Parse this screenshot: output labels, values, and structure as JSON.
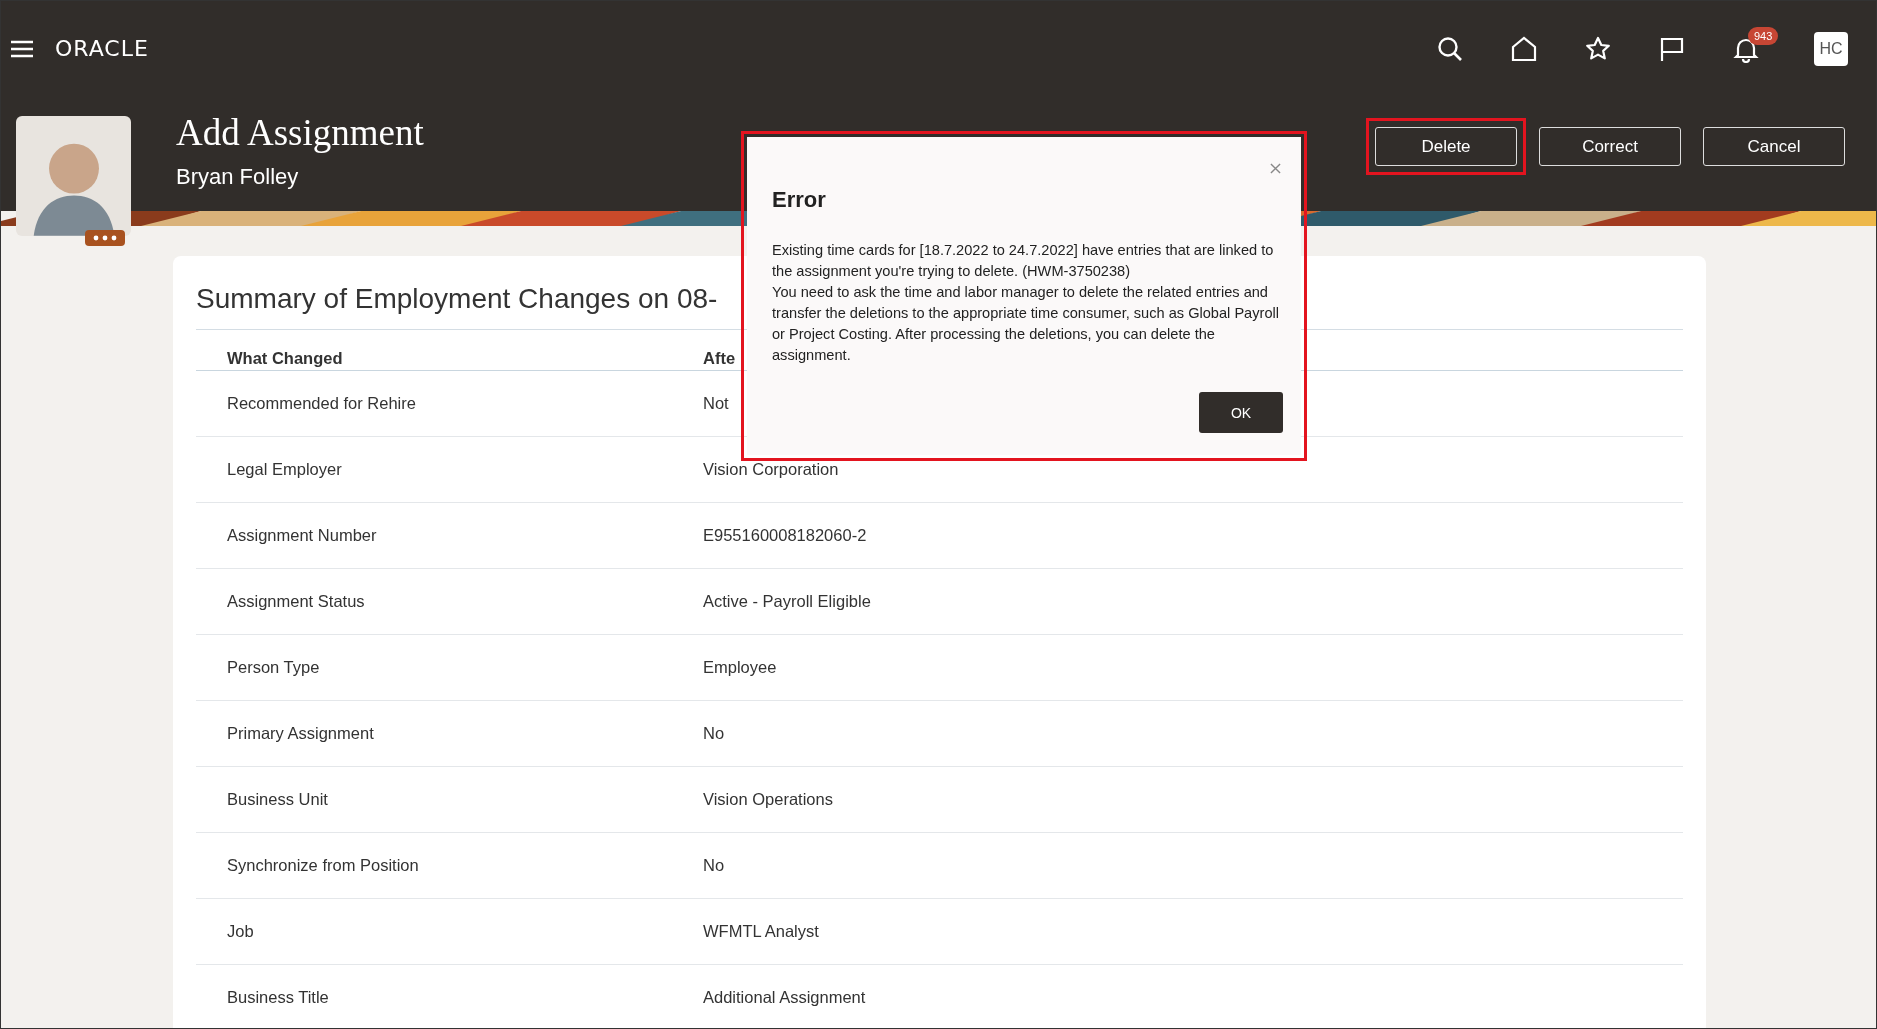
{
  "top_bar": {
    "logo": "ORACLE",
    "notification_count": "943",
    "user_initials": "HC"
  },
  "header": {
    "title": "Add Assignment",
    "subtitle": "Bryan Folley",
    "buttons": [
      {
        "label": "Delete",
        "highlighted": true
      },
      {
        "label": "Correct",
        "highlighted": false
      },
      {
        "label": "Cancel",
        "highlighted": false
      }
    ]
  },
  "summary": {
    "title": "Summary of Employment Changes on 08-",
    "columns": [
      "What Changed",
      "Afte"
    ],
    "rows": [
      {
        "field": "Recommended for Rehire",
        "value": "Not"
      },
      {
        "field": "Legal Employer",
        "value": "Vision Corporation"
      },
      {
        "field": "Assignment Number",
        "value": "E955160008182060-2"
      },
      {
        "field": "Assignment Status",
        "value": "Active - Payroll Eligible"
      },
      {
        "field": "Person Type",
        "value": "Employee"
      },
      {
        "field": "Primary Assignment",
        "value": "No"
      },
      {
        "field": "Business Unit",
        "value": "Vision Operations"
      },
      {
        "field": "Synchronize from Position",
        "value": "No"
      },
      {
        "field": "Job",
        "value": "WFMTL Analyst"
      },
      {
        "field": "Business Title",
        "value": "Additional Assignment"
      }
    ]
  },
  "dialog": {
    "title": "Error",
    "highlighted": true,
    "paragraphs": [
      "Existing time cards for [18.7.2022 to 24.7.2022] have entries that are linked to the assignment you're trying to delete. (HWM-3750238)",
      "You need to ask the time and labor manager to delete the related entries and transfer the deletions to the appropriate time consumer, such as Global Payroll or Project Costing. After processing the deletions, you can delete the assignment."
    ],
    "button": "OK"
  }
}
